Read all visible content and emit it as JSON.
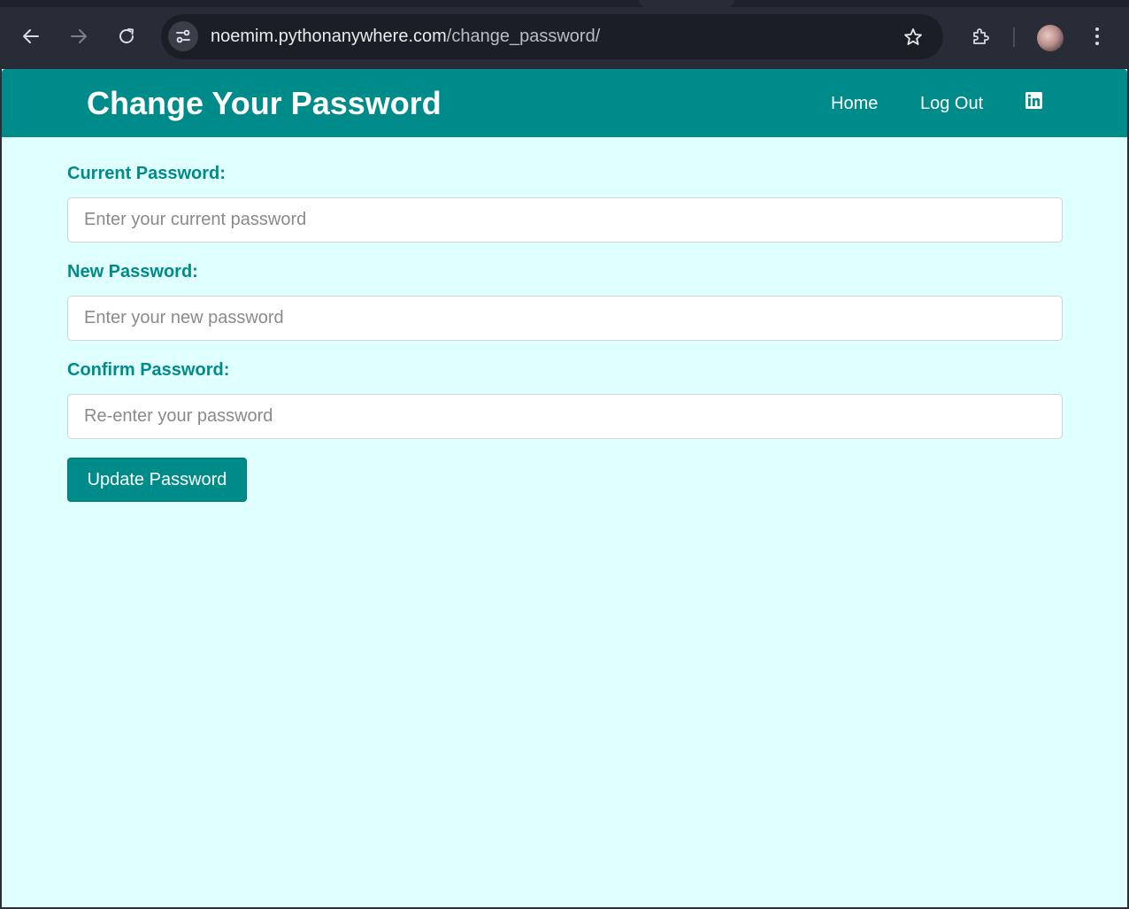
{
  "browser": {
    "url_host": "noemim.pythonanywhere.com",
    "url_path": "/change_password/"
  },
  "header": {
    "title": "Change Your Password",
    "nav": {
      "home": "Home",
      "logout": "Log Out"
    }
  },
  "form": {
    "current": {
      "label": "Current Password:",
      "placeholder": "Enter your current password"
    },
    "new": {
      "label": "New Password:",
      "placeholder": "Enter your new password"
    },
    "confirm": {
      "label": "Confirm Password:",
      "placeholder": "Re-enter your password"
    },
    "submit_label": "Update Password"
  },
  "colors": {
    "primary": "#008b8b",
    "page_background": "#e0ffff",
    "chrome_background": "#282c36"
  },
  "icons": {
    "back": "back-arrow-icon",
    "forward": "forward-arrow-icon",
    "reload": "reload-icon",
    "site_info": "tune-icon",
    "bookmark": "star-icon",
    "extensions": "puzzle-icon",
    "menu": "kebab-menu-icon",
    "social": "linkedin-icon"
  }
}
